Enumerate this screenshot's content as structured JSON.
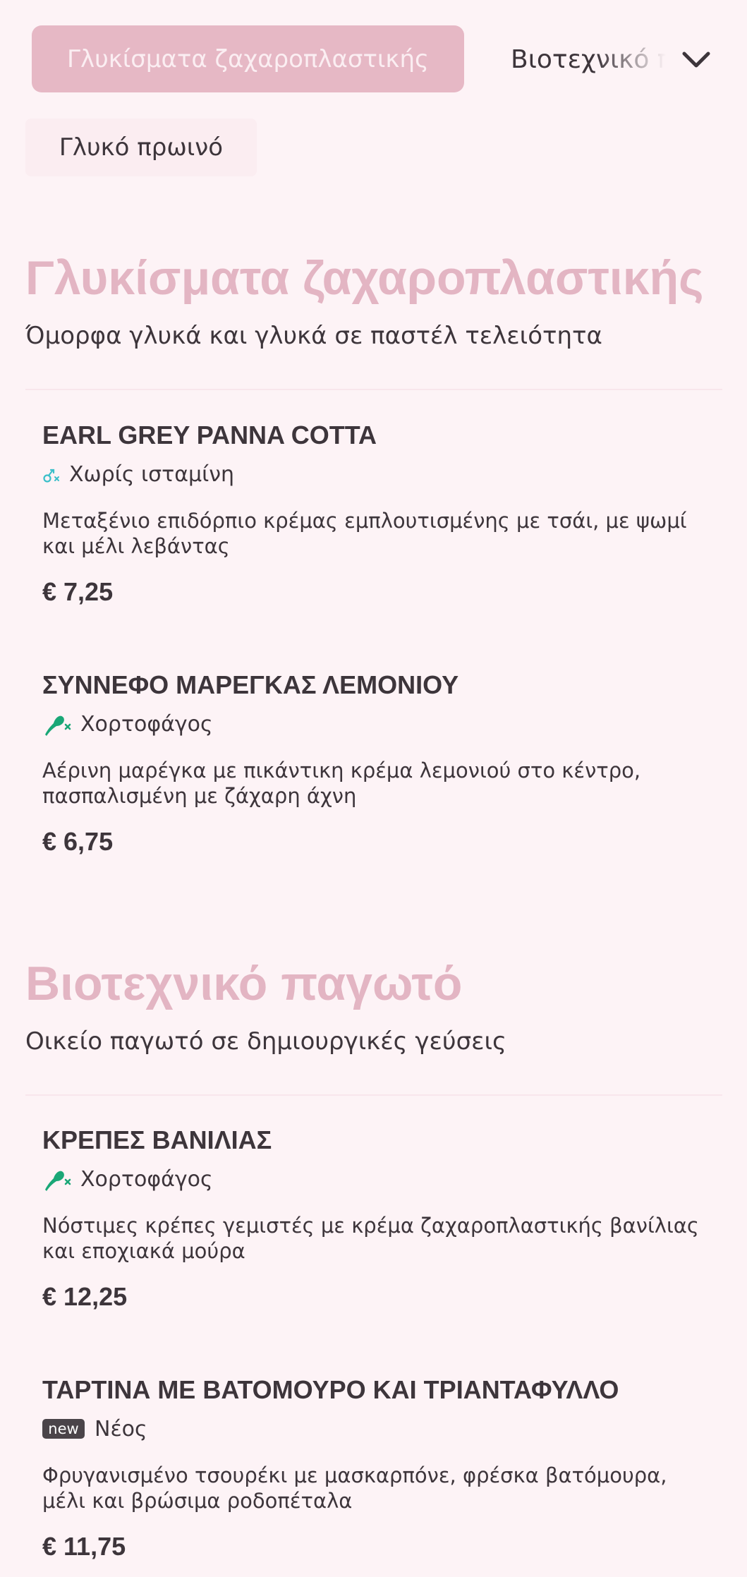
{
  "nav": {
    "active_category": "Γλυκίσματα ζαχαροπλαστικής",
    "next_category": "Βιοτεχνικό παγωτό",
    "second_row_category": "Γλυκό πρωινό"
  },
  "sections": [
    {
      "title": "Γλυκίσματα ζαχαροπλαστικής",
      "subtitle": "Όμορφα γλυκά και γλυκά σε παστέλ τελειότητα",
      "items": [
        {
          "name": "EARL GREY PANNA COTTA",
          "tag_icon": "no-histamine-icon",
          "tag_label": "Χωρίς ισταμίνη",
          "description": "Μεταξένιο επιδόρπιο κρέμας εμπλουτισμένης με τσάι, με ψωμί και μέλι λεβάντας",
          "price": "€ 7,25"
        },
        {
          "name": "ΣΥΝΝΕΦΟ ΜΑΡΕΓΚΑΣ ΛΕΜΟΝΙΟΥ",
          "tag_icon": "vegetarian-icon",
          "tag_label": "Χορτοφάγος",
          "description": "Αέρινη μαρέγκα με πικάντικη κρέμα λεμονιού στο κέντρο, πασπαλισμένη με ζάχαρη άχνη",
          "price": "€ 6,75"
        }
      ]
    },
    {
      "title": "Βιοτεχνικό παγωτό",
      "subtitle": "Οικείο παγωτό σε δημιουργικές γεύσεις",
      "items": [
        {
          "name": "ΚΡΕΠΕΣ ΒΑΝΙΛΙΑΣ",
          "tag_icon": "vegetarian-icon",
          "tag_label": "Χορτοφάγος",
          "description": "Νόστιμες κρέπες γεμιστές με κρέμα ζαχαροπλαστικής βανίλιας και εποχιακά μούρα",
          "price": "€ 12,25"
        },
        {
          "name": "ΤΑΡΤΙΝΑ ΜΕ ΒΑΤΟΜΟΥΡΟ ΚΑΙ ΤΡΙΑΝΤΑΦΥΛΛΟ",
          "tag_icon": "new-badge-icon",
          "tag_badge": "new",
          "tag_label": "Νέος",
          "description": "Φρυγανισμένο τσουρέκι με μασκαρπόνε, φρέσκα βατόμουρα, μέλι και βρώσιμα ροδοπέταλα",
          "price": "€ 11,75"
        }
      ]
    }
  ],
  "colors": {
    "background": "#fdf3f6",
    "accent_pink": "#e3b5c3",
    "active_pill": "#e6b8c5",
    "vegetarian_green": "#1aa777",
    "histamine_teal": "#3bbfc9",
    "text": "#3d353b"
  }
}
